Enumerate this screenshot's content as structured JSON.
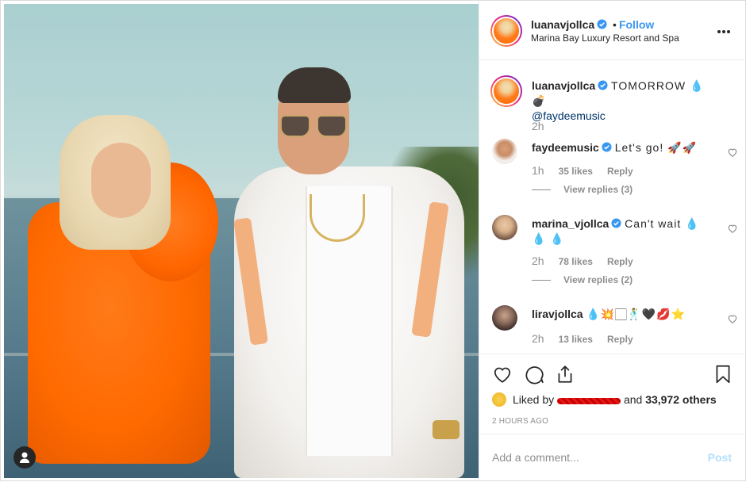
{
  "post": {
    "username": "luanavjollca",
    "follow_label": "Follow",
    "dot": "•",
    "location": "Marina Bay Luxury Resort and Spa"
  },
  "caption": {
    "username": "luanavjollca",
    "text": "TOMORROW 💧💣",
    "mention": "@faydeemusic",
    "time": "2h"
  },
  "comments": [
    {
      "username": "faydeemusic",
      "text": "Let's go! 🚀🚀",
      "time": "1h",
      "likes": "35 likes",
      "reply": "Reply",
      "view_replies": "View replies (3)"
    },
    {
      "username": "marina_vjollca",
      "text": "Can't wait 💧💧 💧",
      "time": "2h",
      "likes": "78 likes",
      "reply": "Reply",
      "view_replies": "View replies (2)"
    },
    {
      "username": "liravjollca",
      "text": "💧💥🏻🕺🖤💋⭐",
      "time": "2h",
      "likes": "13 likes",
      "reply": "Reply"
    }
  ],
  "likes": {
    "prefix": "Liked by",
    "suffix": "and",
    "others": "33,972 others"
  },
  "timestamp": "2 HOURS AGO",
  "comment_box": {
    "placeholder": "Add a comment...",
    "post_label": "Post"
  },
  "colors": {
    "accent": "#3897f0",
    "verified": "#3897f0",
    "post_disabled": "#b2dffc",
    "muted": "#8e8e8e"
  },
  "icons": [
    "more-options-icon",
    "verified-icon",
    "heart-icon",
    "comment-icon",
    "share-icon",
    "bookmark-icon",
    "user-tag-icon"
  ]
}
